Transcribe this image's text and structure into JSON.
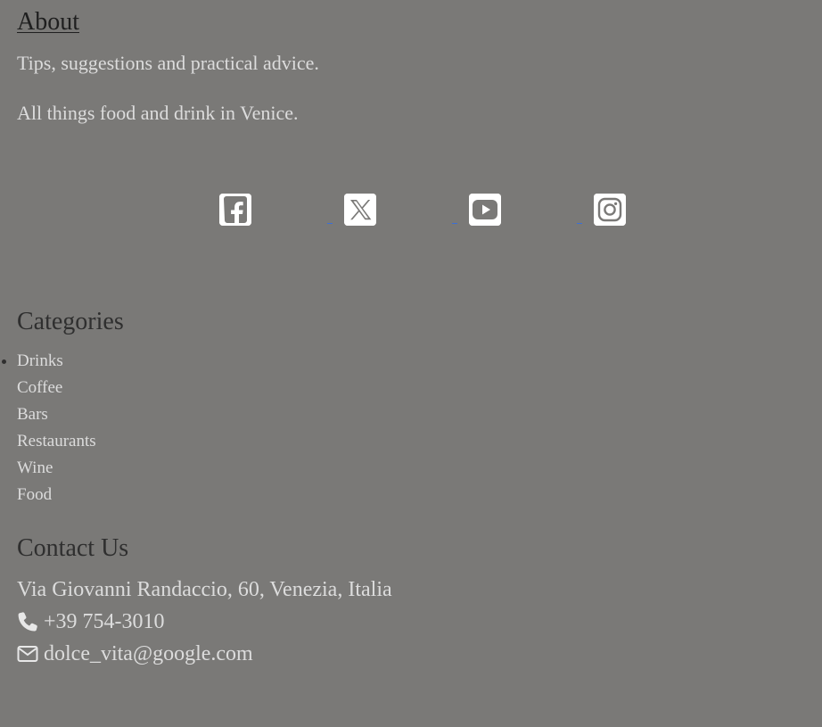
{
  "about": {
    "title": "About",
    "lines": [
      "Tips, suggestions and practical advice.",
      "All things food and drink in Venice."
    ]
  },
  "social": [
    {
      "name": "facebook",
      "icon": "facebook-icon"
    },
    {
      "name": "x",
      "icon": "x-icon"
    },
    {
      "name": "youtube",
      "icon": "youtube-icon"
    },
    {
      "name": "instagram",
      "icon": "instagram-icon"
    }
  ],
  "categories": {
    "title": "Categories",
    "items": [
      "Drinks",
      "Coffee",
      "Bars",
      "Restaurants",
      "Wine",
      "Food"
    ]
  },
  "contact": {
    "title": "Contact Us",
    "address": "Via Giovanni Randaccio, 60, Venezia, Italia",
    "phone": "+39 754-3010",
    "email": "dolce_vita@google.com",
    "phone_icon": "phone-icon",
    "email_icon": "envelope-icon"
  },
  "colors": {
    "background": "#7a7977",
    "text_light": "#dcdcdc",
    "heading_dark": "#2f2f2f",
    "link_blue": "#3b6fd6",
    "icon_bg": "#ffffff"
  }
}
